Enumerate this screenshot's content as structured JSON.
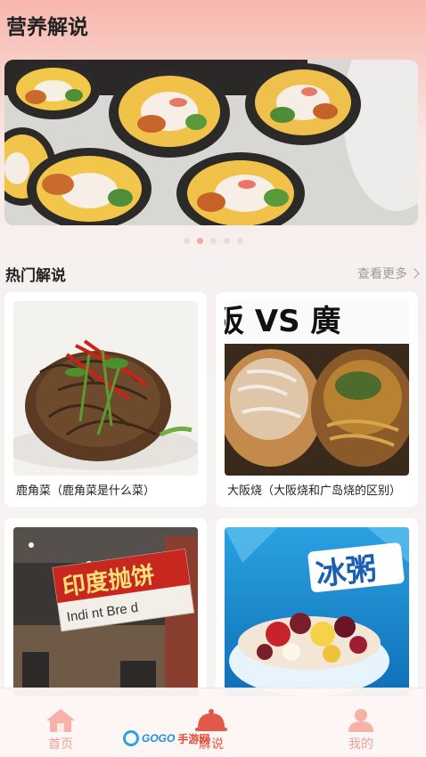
{
  "header": {
    "title": "营养解说"
  },
  "carousel": {
    "page_count": 5,
    "active_index": 1
  },
  "section": {
    "title": "热门解说",
    "see_more": "查看更多"
  },
  "cards": [
    {
      "caption": "鹿角菜（鹿角菜是什么菜）"
    },
    {
      "caption": "大阪烧（大阪烧和广岛烧的区别）",
      "image_text": "阪 VS 廣"
    },
    {
      "caption": "",
      "image_text": "印度抛饼",
      "image_subtext": "Indi  nt  Bre d"
    },
    {
      "caption": "",
      "image_text": "冰粥"
    }
  ],
  "tabbar": {
    "items": [
      {
        "label": "首页",
        "icon": "home-icon"
      },
      {
        "label": "解说",
        "icon": "cloche-icon"
      },
      {
        "label": "我的",
        "icon": "person-icon"
      }
    ],
    "active_color": "#e35a4a",
    "inactive_color": "#f2a196"
  },
  "watermark": {
    "text_a": "GOGO",
    "text_b": "手游网"
  },
  "colors": {
    "accent": "#f3a99e",
    "header_gradient": "#f7b7ad"
  }
}
